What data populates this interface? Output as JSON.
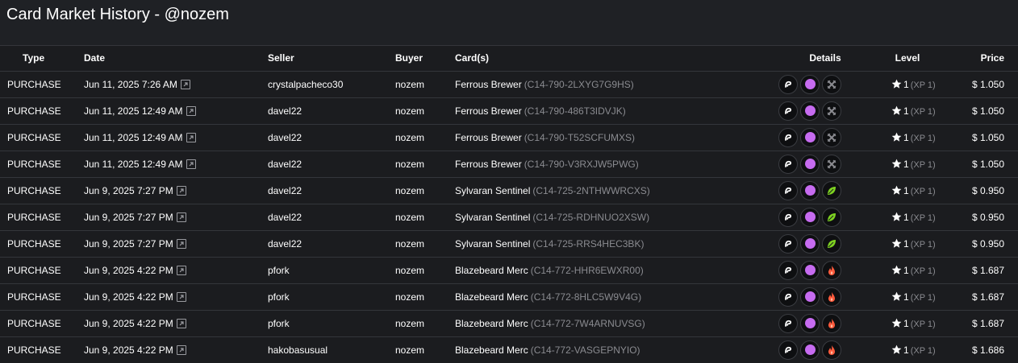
{
  "page": {
    "title": "Card Market History - @nozem"
  },
  "columns": {
    "type": "Type",
    "date": "Date",
    "seller": "Seller",
    "buyer": "Buyer",
    "cards": "Card(s)",
    "details": "Details",
    "level": "Level",
    "price": "Price"
  },
  "colors": {
    "background": "#1e1f22",
    "foil_dot": "#c66bf0",
    "earth_leaf": "#7ed321",
    "fire": "#ff5a3c",
    "muted": "#8a8b90"
  },
  "rows": [
    {
      "type": "PURCHASE",
      "date": "Jun 11, 2025 7:26 AM",
      "seller": "crystalpacheco30",
      "buyer": "nozem",
      "card_name": "Ferrous Brewer",
      "card_uid": "(C14-790-2LXYG7G9HS)",
      "element_icon": "neutral-swords-icon",
      "level": "1",
      "xp": "(XP 1)",
      "price": "$ 1.050"
    },
    {
      "type": "PURCHASE",
      "date": "Jun 11, 2025 12:49 AM",
      "seller": "davel22",
      "buyer": "nozem",
      "card_name": "Ferrous Brewer",
      "card_uid": "(C14-790-486T3IDVJK)",
      "element_icon": "neutral-swords-icon",
      "level": "1",
      "xp": "(XP 1)",
      "price": "$ 1.050"
    },
    {
      "type": "PURCHASE",
      "date": "Jun 11, 2025 12:49 AM",
      "seller": "davel22",
      "buyer": "nozem",
      "card_name": "Ferrous Brewer",
      "card_uid": "(C14-790-T52SCFUMXS)",
      "element_icon": "neutral-swords-icon",
      "level": "1",
      "xp": "(XP 1)",
      "price": "$ 1.050"
    },
    {
      "type": "PURCHASE",
      "date": "Jun 11, 2025 12:49 AM",
      "seller": "davel22",
      "buyer": "nozem",
      "card_name": "Ferrous Brewer",
      "card_uid": "(C14-790-V3RXJW5PWG)",
      "element_icon": "neutral-swords-icon",
      "level": "1",
      "xp": "(XP 1)",
      "price": "$ 1.050"
    },
    {
      "type": "PURCHASE",
      "date": "Jun 9, 2025 7:27 PM",
      "seller": "davel22",
      "buyer": "nozem",
      "card_name": "Sylvaran Sentinel",
      "card_uid": "(C14-725-2NTHWWRCXS)",
      "element_icon": "earth-leaf-icon",
      "level": "1",
      "xp": "(XP 1)",
      "price": "$ 0.950"
    },
    {
      "type": "PURCHASE",
      "date": "Jun 9, 2025 7:27 PM",
      "seller": "davel22",
      "buyer": "nozem",
      "card_name": "Sylvaran Sentinel",
      "card_uid": "(C14-725-RDHNUO2XSW)",
      "element_icon": "earth-leaf-icon",
      "level": "1",
      "xp": "(XP 1)",
      "price": "$ 0.950"
    },
    {
      "type": "PURCHASE",
      "date": "Jun 9, 2025 7:27 PM",
      "seller": "davel22",
      "buyer": "nozem",
      "card_name": "Sylvaran Sentinel",
      "card_uid": "(C14-725-RRS4HEC3BK)",
      "element_icon": "earth-leaf-icon",
      "level": "1",
      "xp": "(XP 1)",
      "price": "$ 0.950"
    },
    {
      "type": "PURCHASE",
      "date": "Jun 9, 2025 4:22 PM",
      "seller": "pfork",
      "buyer": "nozem",
      "card_name": "Blazebeard Merc",
      "card_uid": "(C14-772-HHR6EWXR00)",
      "element_icon": "fire-icon",
      "level": "1",
      "xp": "(XP 1)",
      "price": "$ 1.687"
    },
    {
      "type": "PURCHASE",
      "date": "Jun 9, 2025 4:22 PM",
      "seller": "pfork",
      "buyer": "nozem",
      "card_name": "Blazebeard Merc",
      "card_uid": "(C14-772-8HLC5W9V4G)",
      "element_icon": "fire-icon",
      "level": "1",
      "xp": "(XP 1)",
      "price": "$ 1.687"
    },
    {
      "type": "PURCHASE",
      "date": "Jun 9, 2025 4:22 PM",
      "seller": "pfork",
      "buyer": "nozem",
      "card_name": "Blazebeard Merc",
      "card_uid": "(C14-772-7W4ARNUVSG)",
      "element_icon": "fire-icon",
      "level": "1",
      "xp": "(XP 1)",
      "price": "$ 1.687"
    },
    {
      "type": "PURCHASE",
      "date": "Jun 9, 2025 4:22 PM",
      "seller": "hakobasusual",
      "buyer": "nozem",
      "card_name": "Blazebeard Merc",
      "card_uid": "(C14-772-VASGEPNYIO)",
      "element_icon": "fire-icon",
      "level": "1",
      "xp": "(XP 1)",
      "price": "$ 1.686"
    }
  ]
}
